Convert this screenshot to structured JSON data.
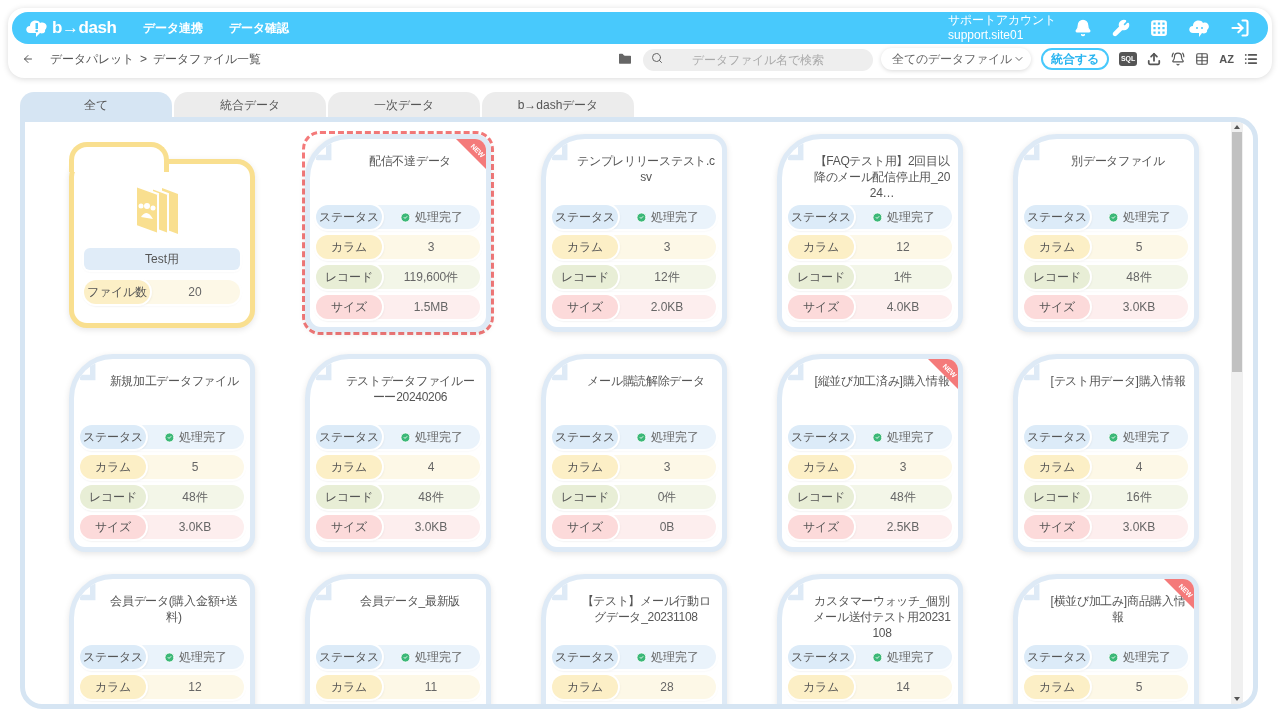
{
  "header": {
    "logo_text": "b→dash",
    "nav": [
      "データ連携",
      "データ確認"
    ],
    "account": {
      "name": "サポートアカウント",
      "id": "support.site01"
    }
  },
  "toolbar": {
    "breadcrumb": [
      "データパレット",
      ">",
      "データファイル一覧"
    ],
    "search": {
      "placeholder": "データファイル名で検索"
    },
    "filter": "全てのデータファイル",
    "merge_button": "統合する",
    "sql_label": "SQL",
    "sort_label": "AZ"
  },
  "tabs": [
    {
      "label": "全て",
      "selected": true
    },
    {
      "label": "統合データ",
      "selected": false
    },
    {
      "label": "一次データ",
      "selected": false
    },
    {
      "label": "b→dashデータ",
      "selected": false
    }
  ],
  "cards": [
    {
      "kind": "folder",
      "name": "Test用",
      "selected": false,
      "fields": [
        {
          "kind": "count",
          "label": "ファイル数",
          "value": "20"
        }
      ]
    },
    {
      "kind": "file",
      "name": "配信不達データ",
      "selected": true,
      "badge": "NEW",
      "fields": [
        {
          "kind": "status",
          "label": "ステータス",
          "value": "処理完了"
        },
        {
          "kind": "columns",
          "label": "カラム",
          "value": "3"
        },
        {
          "kind": "records",
          "label": "レコード",
          "value": "119,600件"
        },
        {
          "kind": "size",
          "label": "サイズ",
          "value": "1.5MB"
        }
      ]
    },
    {
      "kind": "file",
      "name": "テンプレリリーステスト.csv",
      "selected": false,
      "fields": [
        {
          "kind": "status",
          "label": "ステータス",
          "value": "処理完了"
        },
        {
          "kind": "columns",
          "label": "カラム",
          "value": "3"
        },
        {
          "kind": "records",
          "label": "レコード",
          "value": "12件"
        },
        {
          "kind": "size",
          "label": "サイズ",
          "value": "2.0KB"
        }
      ]
    },
    {
      "kind": "file",
      "name": "【FAQテスト用】2回目以降のメール配信停止用_2024…",
      "selected": false,
      "fields": [
        {
          "kind": "status",
          "label": "ステータス",
          "value": "処理完了"
        },
        {
          "kind": "columns",
          "label": "カラム",
          "value": "12"
        },
        {
          "kind": "records",
          "label": "レコード",
          "value": "1件"
        },
        {
          "kind": "size",
          "label": "サイズ",
          "value": "4.0KB"
        }
      ]
    },
    {
      "kind": "file",
      "name": "別データファイル",
      "selected": false,
      "fields": [
        {
          "kind": "status",
          "label": "ステータス",
          "value": "処理完了"
        },
        {
          "kind": "columns",
          "label": "カラム",
          "value": "5"
        },
        {
          "kind": "records",
          "label": "レコード",
          "value": "48件"
        },
        {
          "kind": "size",
          "label": "サイズ",
          "value": "3.0KB"
        }
      ]
    },
    {
      "kind": "file",
      "name": "新規加工データファイル",
      "selected": false,
      "fields": [
        {
          "kind": "status",
          "label": "ステータス",
          "value": "処理完了"
        },
        {
          "kind": "columns",
          "label": "カラム",
          "value": "5"
        },
        {
          "kind": "records",
          "label": "レコード",
          "value": "48件"
        },
        {
          "kind": "size",
          "label": "サイズ",
          "value": "3.0KB"
        }
      ]
    },
    {
      "kind": "file",
      "name": "テストデータファイルーーー20240206",
      "selected": false,
      "fields": [
        {
          "kind": "status",
          "label": "ステータス",
          "value": "処理完了"
        },
        {
          "kind": "columns",
          "label": "カラム",
          "value": "4"
        },
        {
          "kind": "records",
          "label": "レコード",
          "value": "48件"
        },
        {
          "kind": "size",
          "label": "サイズ",
          "value": "3.0KB"
        }
      ]
    },
    {
      "kind": "file",
      "name": "メール購読解除データ",
      "selected": false,
      "fields": [
        {
          "kind": "status",
          "label": "ステータス",
          "value": "処理完了"
        },
        {
          "kind": "columns",
          "label": "カラム",
          "value": "3"
        },
        {
          "kind": "records",
          "label": "レコード",
          "value": "0件"
        },
        {
          "kind": "size",
          "label": "サイズ",
          "value": "0B"
        }
      ]
    },
    {
      "kind": "file",
      "name": "[縦並び加工済み]購入情報",
      "selected": false,
      "badge": "NEW",
      "fields": [
        {
          "kind": "status",
          "label": "ステータス",
          "value": "処理完了"
        },
        {
          "kind": "columns",
          "label": "カラム",
          "value": "3"
        },
        {
          "kind": "records",
          "label": "レコード",
          "value": "48件"
        },
        {
          "kind": "size",
          "label": "サイズ",
          "value": "2.5KB"
        }
      ]
    },
    {
      "kind": "file",
      "name": "[テスト用データ]購入情報",
      "selected": false,
      "fields": [
        {
          "kind": "status",
          "label": "ステータス",
          "value": "処理完了"
        },
        {
          "kind": "columns",
          "label": "カラム",
          "value": "4"
        },
        {
          "kind": "records",
          "label": "レコード",
          "value": "16件"
        },
        {
          "kind": "size",
          "label": "サイズ",
          "value": "3.0KB"
        }
      ]
    },
    {
      "kind": "file",
      "name": "会員データ(購入金額+送料)",
      "selected": false,
      "fields": [
        {
          "kind": "status",
          "label": "ステータス",
          "value": "処理完了"
        },
        {
          "kind": "columns",
          "label": "カラム",
          "value": "12"
        }
      ]
    },
    {
      "kind": "file",
      "name": "会員データ_最新版",
      "selected": false,
      "fields": [
        {
          "kind": "status",
          "label": "ステータス",
          "value": "処理完了"
        },
        {
          "kind": "columns",
          "label": "カラム",
          "value": "11"
        }
      ]
    },
    {
      "kind": "file",
      "name": "【テスト】メール行動ログデータ_20231108",
      "selected": false,
      "fields": [
        {
          "kind": "status",
          "label": "ステータス",
          "value": "処理完了"
        },
        {
          "kind": "columns",
          "label": "カラム",
          "value": "28"
        }
      ]
    },
    {
      "kind": "file",
      "name": "カスタマーウォッチ_個別メール送付テスト用20231108",
      "selected": false,
      "fields": [
        {
          "kind": "status",
          "label": "ステータス",
          "value": "処理完了"
        },
        {
          "kind": "columns",
          "label": "カラム",
          "value": "14"
        }
      ]
    },
    {
      "kind": "file",
      "name": "[横並び加工み]商品購入情報",
      "selected": false,
      "badge": "NEW",
      "fields": [
        {
          "kind": "status",
          "label": "ステータス",
          "value": "処理完了"
        },
        {
          "kind": "columns",
          "label": "カラム",
          "value": "5"
        }
      ]
    }
  ]
}
